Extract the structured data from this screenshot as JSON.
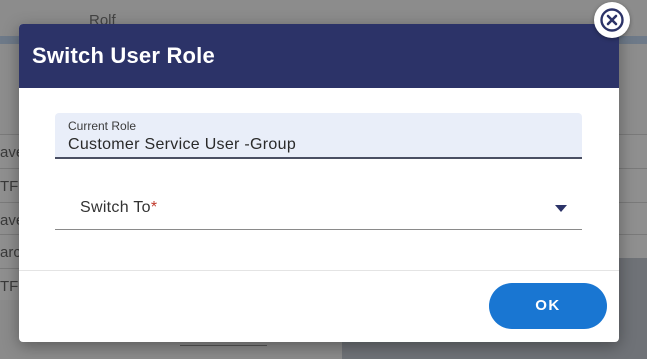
{
  "background": {
    "top_text": "Rolf",
    "row_texts": [
      "ave",
      "TF",
      "ave",
      "arc",
      "TF"
    ]
  },
  "modal": {
    "title": "Switch User Role",
    "current_role": {
      "label": "Current Role",
      "value": "Customer Service User -Group"
    },
    "switch_to": {
      "label": "Switch To",
      "required_marker": "*",
      "selected_value": ""
    },
    "ok_label": "OK"
  },
  "icons": {
    "close": "close-circle-icon",
    "dropdown": "caret-down-icon"
  },
  "colors": {
    "header_bg": "#2c3368",
    "primary_button": "#1976d2",
    "field_bg": "#e9eef9",
    "required": "#c0392b"
  }
}
